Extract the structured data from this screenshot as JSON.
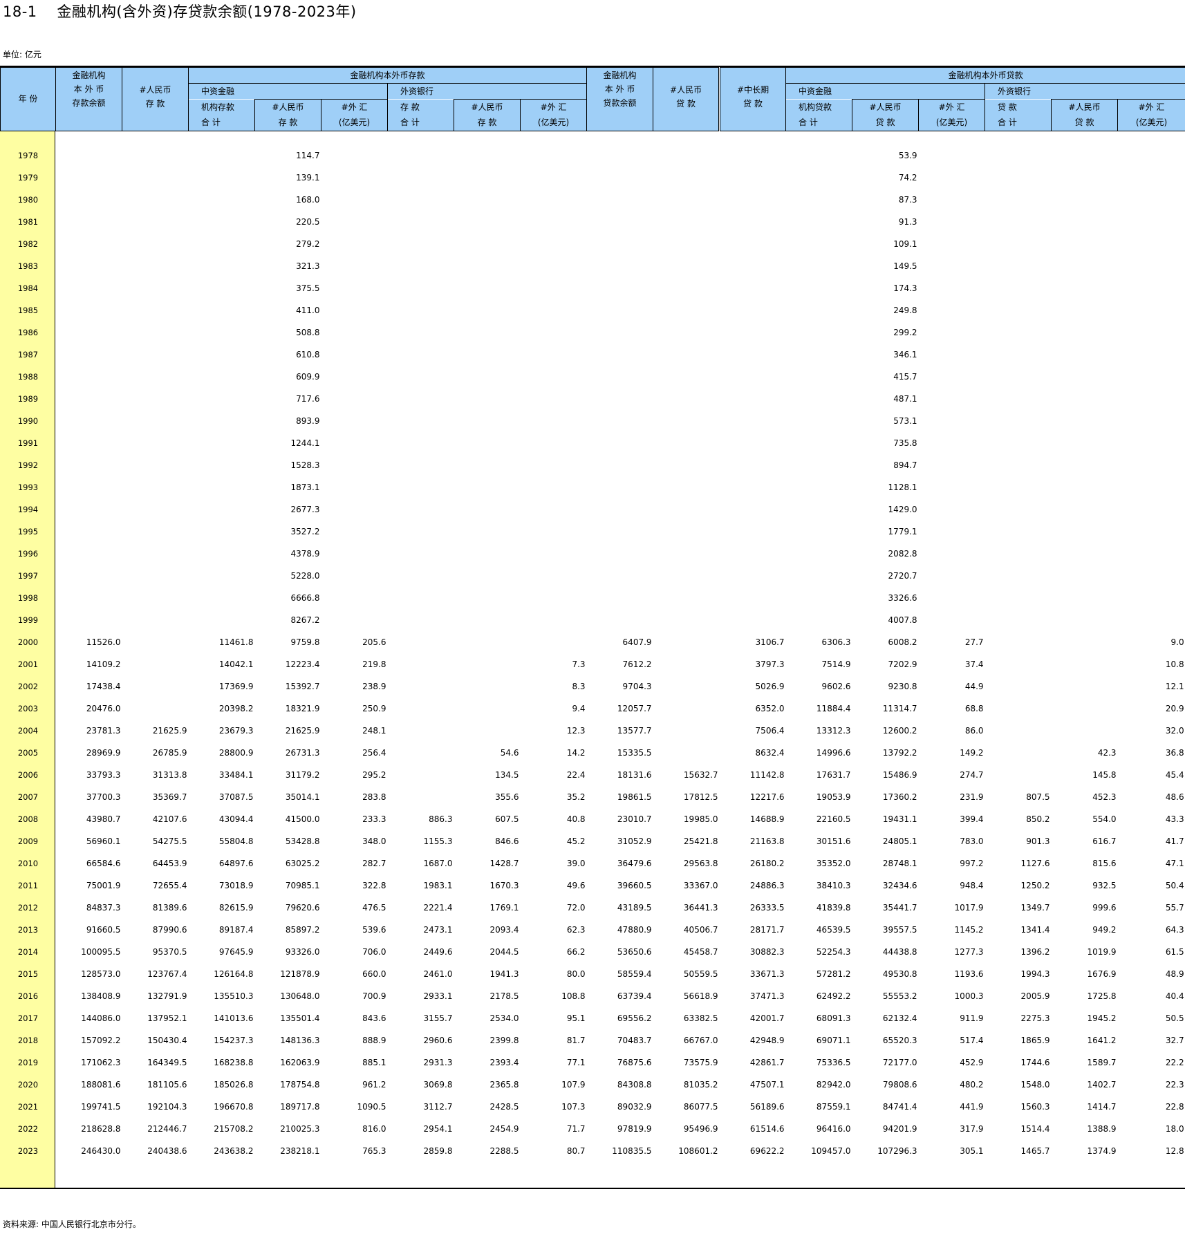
{
  "title": "18-1    金融机构(含外资)存贷款余额(1978-2023年)",
  "unit": "单位: 亿元",
  "source": "资料来源: 中国人民银行北京市分行。",
  "colors": {
    "header_bg": "#9fcff7",
    "year_col_bg": "#fefea2"
  },
  "headers": {
    "year": "年 份",
    "deposit_group": "金融机构本外币存款",
    "loan_group": "金融机构本外币贷款",
    "total_deposit": [
      "金融机构",
      "本 外 币",
      "存款余额"
    ],
    "rmb_deposit": [
      "#人民币",
      "存 款"
    ],
    "chinese_fi_deposit": [
      "中资金融",
      "机构存款",
      "合 计"
    ],
    "cfi_rmb_deposit": [
      "#人民币",
      "存 款"
    ],
    "cfi_fx_deposit": [
      "#外 汇",
      "(亿美元)"
    ],
    "foreign_bank_deposit": [
      "外资银行",
      "存 款",
      "合 计"
    ],
    "fb_rmb_deposit": [
      "#人民币",
      "存 款"
    ],
    "fb_fx_deposit": [
      "#外 汇",
      "(亿美元)"
    ],
    "total_loan": [
      "金融机构",
      "本 外 币",
      "贷款余额"
    ],
    "rmb_loan": [
      "#人民币",
      "贷 款"
    ],
    "mid_long_loan": [
      "#中长期",
      "贷 款"
    ],
    "chinese_fi_loan": [
      "中资金融",
      "机构贷款",
      "合 计"
    ],
    "cfi_rmb_loan": [
      "#人民币",
      "贷 款"
    ],
    "cfi_fx_loan": [
      "#外 汇",
      "(亿美元)"
    ],
    "foreign_bank_loan": [
      "外资银行",
      "贷 款",
      "合 计"
    ],
    "fb_rmb_loan": [
      "#人民币",
      "贷 款"
    ],
    "fb_fx_loan": [
      "#外 汇",
      "(亿美元)"
    ]
  },
  "rows": [
    [
      "1978",
      "",
      "",
      "",
      "114.7",
      "",
      "",
      "",
      "",
      "",
      "",
      "",
      "",
      "53.9",
      "",
      "",
      "",
      ""
    ],
    [
      "1979",
      "",
      "",
      "",
      "139.1",
      "",
      "",
      "",
      "",
      "",
      "",
      "",
      "",
      "74.2",
      "",
      "",
      "",
      ""
    ],
    [
      "1980",
      "",
      "",
      "",
      "168.0",
      "",
      "",
      "",
      "",
      "",
      "",
      "",
      "",
      "87.3",
      "",
      "",
      "",
      ""
    ],
    [
      "1981",
      "",
      "",
      "",
      "220.5",
      "",
      "",
      "",
      "",
      "",
      "",
      "",
      "",
      "91.3",
      "",
      "",
      "",
      ""
    ],
    [
      "1982",
      "",
      "",
      "",
      "279.2",
      "",
      "",
      "",
      "",
      "",
      "",
      "",
      "",
      "109.1",
      "",
      "",
      "",
      ""
    ],
    [
      "1983",
      "",
      "",
      "",
      "321.3",
      "",
      "",
      "",
      "",
      "",
      "",
      "",
      "",
      "149.5",
      "",
      "",
      "",
      ""
    ],
    [
      "1984",
      "",
      "",
      "",
      "375.5",
      "",
      "",
      "",
      "",
      "",
      "",
      "",
      "",
      "174.3",
      "",
      "",
      "",
      ""
    ],
    [
      "1985",
      "",
      "",
      "",
      "411.0",
      "",
      "",
      "",
      "",
      "",
      "",
      "",
      "",
      "249.8",
      "",
      "",
      "",
      ""
    ],
    [
      "1986",
      "",
      "",
      "",
      "508.8",
      "",
      "",
      "",
      "",
      "",
      "",
      "",
      "",
      "299.2",
      "",
      "",
      "",
      ""
    ],
    [
      "1987",
      "",
      "",
      "",
      "610.8",
      "",
      "",
      "",
      "",
      "",
      "",
      "",
      "",
      "346.1",
      "",
      "",
      "",
      ""
    ],
    [
      "1988",
      "",
      "",
      "",
      "609.9",
      "",
      "",
      "",
      "",
      "",
      "",
      "",
      "",
      "415.7",
      "",
      "",
      "",
      ""
    ],
    [
      "1989",
      "",
      "",
      "",
      "717.6",
      "",
      "",
      "",
      "",
      "",
      "",
      "",
      "",
      "487.1",
      "",
      "",
      "",
      ""
    ],
    [
      "1990",
      "",
      "",
      "",
      "893.9",
      "",
      "",
      "",
      "",
      "",
      "",
      "",
      "",
      "573.1",
      "",
      "",
      "",
      ""
    ],
    [
      "1991",
      "",
      "",
      "",
      "1244.1",
      "",
      "",
      "",
      "",
      "",
      "",
      "",
      "",
      "735.8",
      "",
      "",
      "",
      ""
    ],
    [
      "1992",
      "",
      "",
      "",
      "1528.3",
      "",
      "",
      "",
      "",
      "",
      "",
      "",
      "",
      "894.7",
      "",
      "",
      "",
      ""
    ],
    [
      "1993",
      "",
      "",
      "",
      "1873.1",
      "",
      "",
      "",
      "",
      "",
      "",
      "",
      "",
      "1128.1",
      "",
      "",
      "",
      ""
    ],
    [
      "1994",
      "",
      "",
      "",
      "2677.3",
      "",
      "",
      "",
      "",
      "",
      "",
      "",
      "",
      "1429.0",
      "",
      "",
      "",
      ""
    ],
    [
      "1995",
      "",
      "",
      "",
      "3527.2",
      "",
      "",
      "",
      "",
      "",
      "",
      "",
      "",
      "1779.1",
      "",
      "",
      "",
      ""
    ],
    [
      "1996",
      "",
      "",
      "",
      "4378.9",
      "",
      "",
      "",
      "",
      "",
      "",
      "",
      "",
      "2082.8",
      "",
      "",
      "",
      ""
    ],
    [
      "1997",
      "",
      "",
      "",
      "5228.0",
      "",
      "",
      "",
      "",
      "",
      "",
      "",
      "",
      "2720.7",
      "",
      "",
      "",
      ""
    ],
    [
      "1998",
      "",
      "",
      "",
      "6666.8",
      "",
      "",
      "",
      "",
      "",
      "",
      "",
      "",
      "3326.6",
      "",
      "",
      "",
      ""
    ],
    [
      "1999",
      "",
      "",
      "",
      "8267.2",
      "",
      "",
      "",
      "",
      "",
      "",
      "",
      "",
      "4007.8",
      "",
      "",
      "",
      ""
    ],
    [
      "2000",
      "11526.0",
      "",
      "11461.8",
      "9759.8",
      "205.6",
      "",
      "",
      "",
      "6407.9",
      "",
      "3106.7",
      "6306.3",
      "6008.2",
      "27.7",
      "",
      "",
      "9.0"
    ],
    [
      "2001",
      "14109.2",
      "",
      "14042.1",
      "12223.4",
      "219.8",
      "",
      "",
      "7.3",
      "7612.2",
      "",
      "3797.3",
      "7514.9",
      "7202.9",
      "37.4",
      "",
      "",
      "10.8"
    ],
    [
      "2002",
      "17438.4",
      "",
      "17369.9",
      "15392.7",
      "238.9",
      "",
      "",
      "8.3",
      "9704.3",
      "",
      "5026.9",
      "9602.6",
      "9230.8",
      "44.9",
      "",
      "",
      "12.1"
    ],
    [
      "2003",
      "20476.0",
      "",
      "20398.2",
      "18321.9",
      "250.9",
      "",
      "",
      "9.4",
      "12057.7",
      "",
      "6352.0",
      "11884.4",
      "11314.7",
      "68.8",
      "",
      "",
      "20.9"
    ],
    [
      "2004",
      "23781.3",
      "21625.9",
      "23679.3",
      "21625.9",
      "248.1",
      "",
      "",
      "12.3",
      "13577.7",
      "",
      "7506.4",
      "13312.3",
      "12600.2",
      "86.0",
      "",
      "",
      "32.0"
    ],
    [
      "2005",
      "28969.9",
      "26785.9",
      "28800.9",
      "26731.3",
      "256.4",
      "",
      "54.6",
      "14.2",
      "15335.5",
      "",
      "8632.4",
      "14996.6",
      "13792.2",
      "149.2",
      "",
      "42.3",
      "36.8"
    ],
    [
      "2006",
      "33793.3",
      "31313.8",
      "33484.1",
      "31179.2",
      "295.2",
      "",
      "134.5",
      "22.4",
      "18131.6",
      "15632.7",
      "11142.8",
      "17631.7",
      "15486.9",
      "274.7",
      "",
      "145.8",
      "45.4"
    ],
    [
      "2007",
      "37700.3",
      "35369.7",
      "37087.5",
      "35014.1",
      "283.8",
      "",
      "355.6",
      "35.2",
      "19861.5",
      "17812.5",
      "12217.6",
      "19053.9",
      "17360.2",
      "231.9",
      "807.5",
      "452.3",
      "48.6"
    ],
    [
      "2008",
      "43980.7",
      "42107.6",
      "43094.4",
      "41500.0",
      "233.3",
      "886.3",
      "607.5",
      "40.8",
      "23010.7",
      "19985.0",
      "14688.9",
      "22160.5",
      "19431.1",
      "399.4",
      "850.2",
      "554.0",
      "43.3"
    ],
    [
      "2009",
      "56960.1",
      "54275.5",
      "55804.8",
      "53428.8",
      "348.0",
      "1155.3",
      "846.6",
      "45.2",
      "31052.9",
      "25421.8",
      "21163.8",
      "30151.6",
      "24805.1",
      "783.0",
      "901.3",
      "616.7",
      "41.7"
    ],
    [
      "2010",
      "66584.6",
      "64453.9",
      "64897.6",
      "63025.2",
      "282.7",
      "1687.0",
      "1428.7",
      "39.0",
      "36479.6",
      "29563.8",
      "26180.2",
      "35352.0",
      "28748.1",
      "997.2",
      "1127.6",
      "815.6",
      "47.1"
    ],
    [
      "2011",
      "75001.9",
      "72655.4",
      "73018.9",
      "70985.1",
      "322.8",
      "1983.1",
      "1670.3",
      "49.6",
      "39660.5",
      "33367.0",
      "24886.3",
      "38410.3",
      "32434.6",
      "948.4",
      "1250.2",
      "932.5",
      "50.4"
    ],
    [
      "2012",
      "84837.3",
      "81389.6",
      "82615.9",
      "79620.6",
      "476.5",
      "2221.4",
      "1769.1",
      "72.0",
      "43189.5",
      "36441.3",
      "26333.5",
      "41839.8",
      "35441.7",
      "1017.9",
      "1349.7",
      "999.6",
      "55.7"
    ],
    [
      "2013",
      "91660.5",
      "87990.6",
      "89187.4",
      "85897.2",
      "539.6",
      "2473.1",
      "2093.4",
      "62.3",
      "47880.9",
      "40506.7",
      "28171.7",
      "46539.5",
      "39557.5",
      "1145.2",
      "1341.4",
      "949.2",
      "64.3"
    ],
    [
      "2014",
      "100095.5",
      "95370.5",
      "97645.9",
      "93326.0",
      "706.0",
      "2449.6",
      "2044.5",
      "66.2",
      "53650.6",
      "45458.7",
      "30882.3",
      "52254.3",
      "44438.8",
      "1277.3",
      "1396.2",
      "1019.9",
      "61.5"
    ],
    [
      "2015",
      "128573.0",
      "123767.4",
      "126164.8",
      "121878.9",
      "660.0",
      "2461.0",
      "1941.3",
      "80.0",
      "58559.4",
      "50559.5",
      "33671.3",
      "57281.2",
      "49530.8",
      "1193.6",
      "1994.3",
      "1676.9",
      "48.9"
    ],
    [
      "2016",
      "138408.9",
      "132791.9",
      "135510.3",
      "130648.0",
      "700.9",
      "2933.1",
      "2178.5",
      "108.8",
      "63739.4",
      "56618.9",
      "37471.3",
      "62492.2",
      "55553.2",
      "1000.3",
      "2005.9",
      "1725.8",
      "40.4"
    ],
    [
      "2017",
      "144086.0",
      "137952.1",
      "141013.6",
      "135501.4",
      "843.6",
      "3155.7",
      "2534.0",
      "95.1",
      "69556.2",
      "63382.5",
      "42001.7",
      "68091.3",
      "62132.4",
      "911.9",
      "2275.3",
      "1945.2",
      "50.5"
    ],
    [
      "2018",
      "157092.2",
      "150430.4",
      "154237.3",
      "148136.3",
      "888.9",
      "2960.6",
      "2399.8",
      "81.7",
      "70483.7",
      "66767.0",
      "42948.9",
      "69071.1",
      "65520.3",
      "517.4",
      "1865.9",
      "1641.2",
      "32.7"
    ],
    [
      "2019",
      "171062.3",
      "164349.5",
      "168238.8",
      "162063.9",
      "885.1",
      "2931.3",
      "2393.4",
      "77.1",
      "76875.6",
      "73575.9",
      "42861.7",
      "75336.5",
      "72177.0",
      "452.9",
      "1744.6",
      "1589.7",
      "22.2"
    ],
    [
      "2020",
      "188081.6",
      "181105.6",
      "185026.8",
      "178754.8",
      "961.2",
      "3069.8",
      "2365.8",
      "107.9",
      "84308.8",
      "81035.2",
      "47507.1",
      "82942.0",
      "79808.6",
      "480.2",
      "1548.0",
      "1402.7",
      "22.3"
    ],
    [
      "2021",
      "199741.5",
      "192104.3",
      "196670.8",
      "189717.8",
      "1090.5",
      "3112.7",
      "2428.5",
      "107.3",
      "89032.9",
      "86077.5",
      "56189.6",
      "87559.1",
      "84741.4",
      "441.9",
      "1560.3",
      "1414.7",
      "22.8"
    ],
    [
      "2022",
      "218628.8",
      "212446.7",
      "215708.2",
      "210025.3",
      "816.0",
      "2954.1",
      "2454.9",
      "71.7",
      "97819.9",
      "95496.9",
      "61514.6",
      "96416.0",
      "94201.9",
      "317.9",
      "1514.4",
      "1388.9",
      "18.0"
    ],
    [
      "2023",
      "246430.0",
      "240438.6",
      "243638.2",
      "238218.1",
      "765.3",
      "2859.8",
      "2288.5",
      "80.7",
      "110835.5",
      "108601.2",
      "69622.2",
      "109457.0",
      "107296.3",
      "305.1",
      "1465.7",
      "1374.9",
      "12.8"
    ]
  ]
}
